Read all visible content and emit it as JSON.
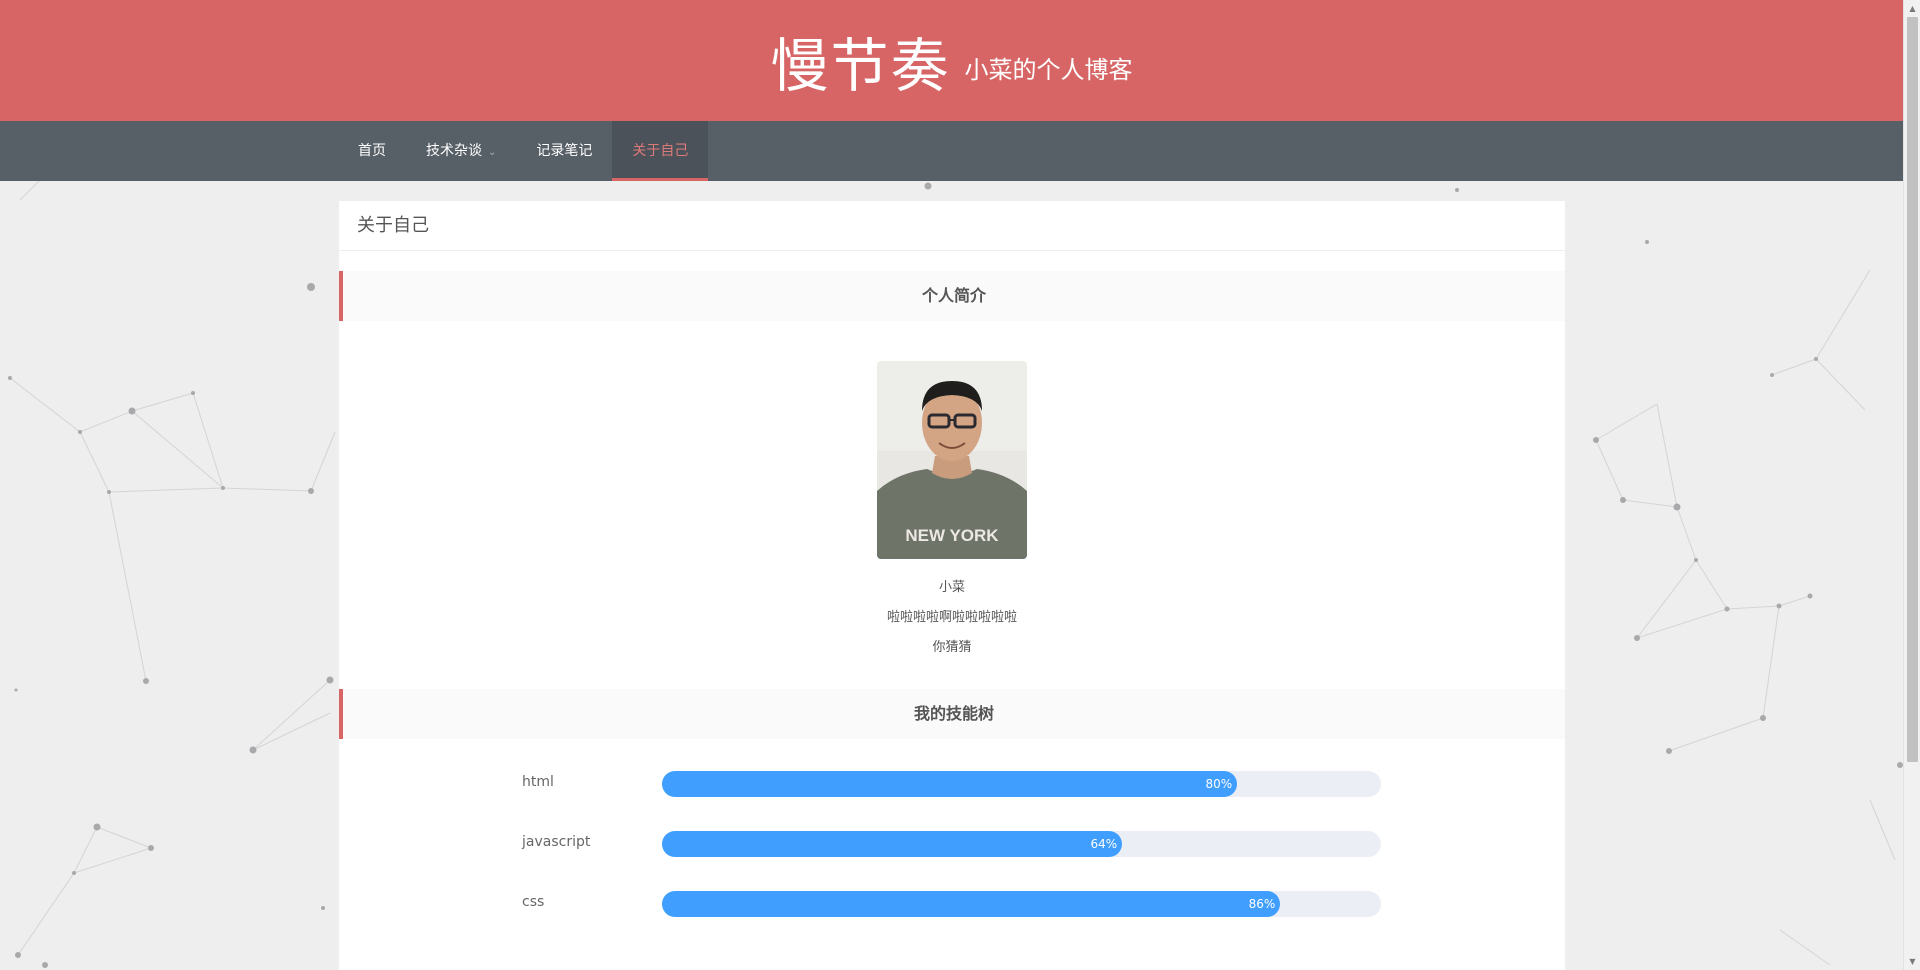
{
  "header": {
    "title": "慢节奏",
    "subtitle": "小菜的个人博客"
  },
  "nav": {
    "items": [
      {
        "label": "首页",
        "active": false,
        "dropdown": false
      },
      {
        "label": "技术杂谈",
        "active": false,
        "dropdown": true
      },
      {
        "label": "记录笔记",
        "active": false,
        "dropdown": false
      },
      {
        "label": "关于自己",
        "active": true,
        "dropdown": false
      }
    ]
  },
  "page": {
    "title": "关于自己"
  },
  "intro": {
    "heading": "个人简介",
    "name": "小菜",
    "motto": "啦啦啦啦啊啦啦啦啦啦",
    "extra": "你猜猜",
    "avatar_shirt_text": "NEW YORK"
  },
  "skills": {
    "heading": "我的技能树",
    "items": [
      {
        "name": "html",
        "percent": 80,
        "label": "80%"
      },
      {
        "name": "javascript",
        "percent": 64,
        "label": "64%"
      },
      {
        "name": "css",
        "percent": 86,
        "label": "86%"
      }
    ]
  },
  "colors": {
    "header_bg": "#d76565",
    "nav_bg": "#575f67",
    "progress": "#409eff",
    "track": "#ebeef5"
  }
}
